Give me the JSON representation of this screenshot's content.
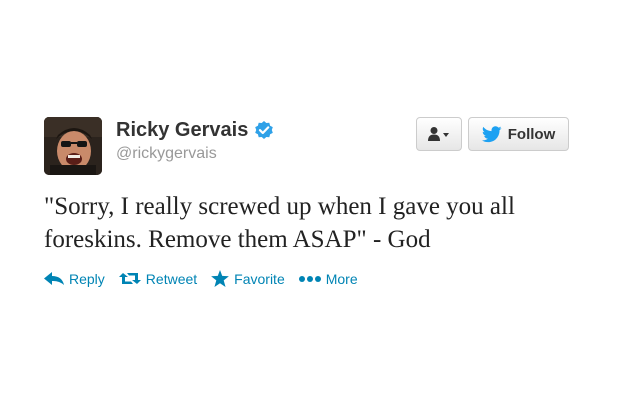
{
  "user": {
    "full_name": "Ricky Gervais",
    "screen_name": "@rickygervais",
    "verified": true
  },
  "buttons": {
    "follow_label": "Follow",
    "user_menu_icon": "user-dropdown-icon"
  },
  "tweet": {
    "text": "\"Sorry, I really screwed up when I gave you all foreskins. Remove them ASAP\" - God"
  },
  "actions": [
    {
      "label": "Reply",
      "icon": "reply-arrow-icon"
    },
    {
      "label": "Retweet",
      "icon": "retweet-icon"
    },
    {
      "label": "Favorite",
      "icon": "star-icon"
    },
    {
      "label": "More",
      "icon": "ellipsis-icon"
    }
  ],
  "colors": {
    "link": "#0084b4",
    "verified": "#2fa1e8",
    "twitter_bird": "#1da1f2",
    "name": "#333333",
    "screen_name": "#999999"
  }
}
